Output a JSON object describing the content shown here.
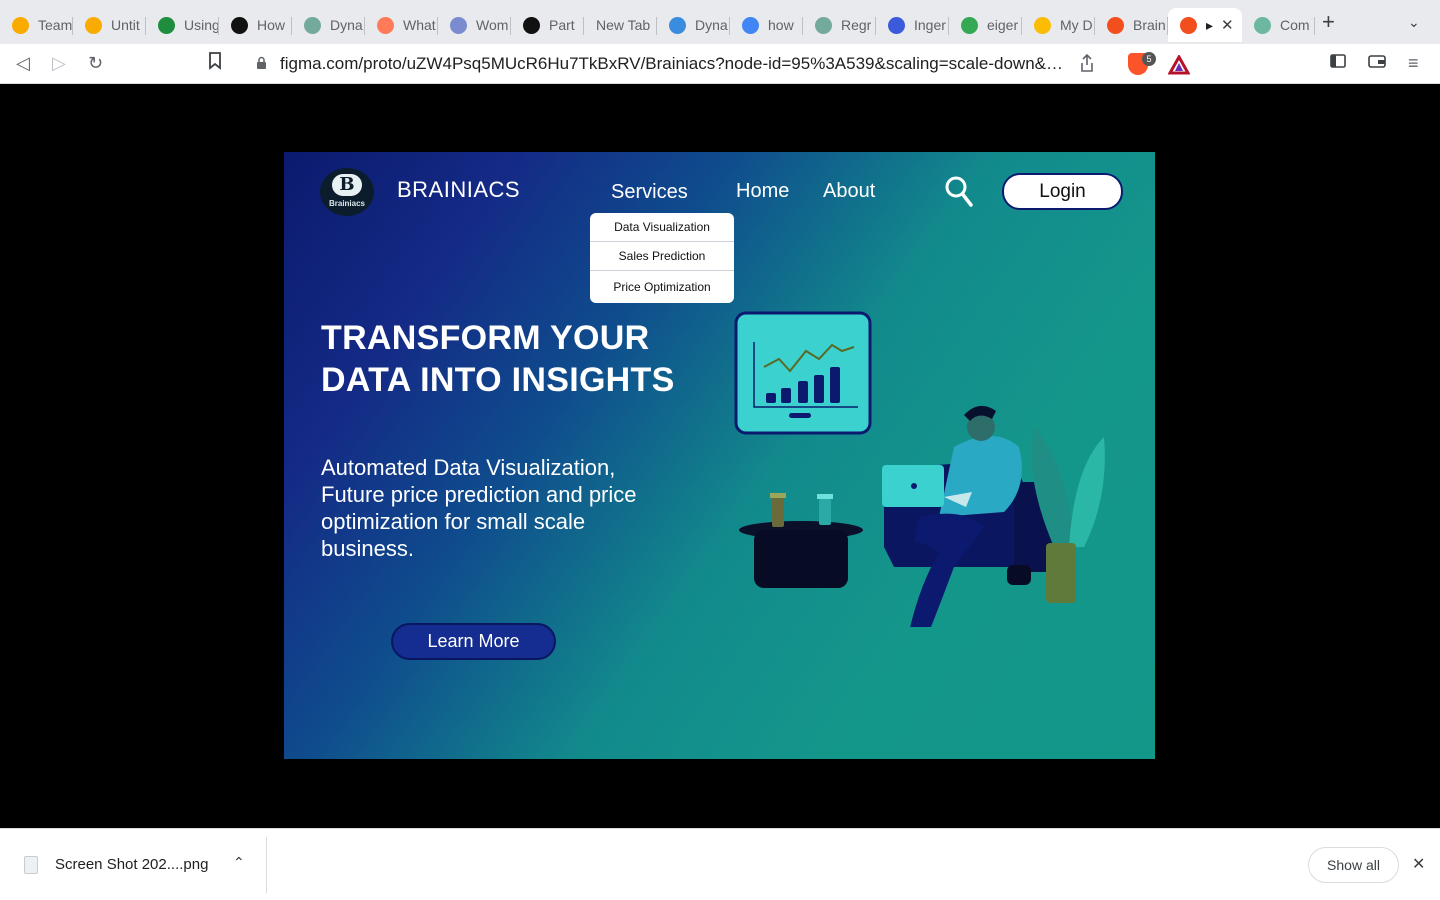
{
  "browser": {
    "tabs": [
      {
        "label": "Team",
        "icon": "colab-icon",
        "color": "#f9ab00"
      },
      {
        "label": "Untit",
        "icon": "colab-icon",
        "color": "#f9ab00"
      },
      {
        "label": "Using",
        "icon": "glasses-icon",
        "color": "#1e8e3e"
      },
      {
        "label": "How",
        "icon": "dark-circle-icon",
        "color": "#111111"
      },
      {
        "label": "Dyna",
        "icon": "openai-icon",
        "color": "#74aa9c"
      },
      {
        "label": "What",
        "icon": "hubspot-icon",
        "color": "#ff7a59"
      },
      {
        "label": "Wom",
        "icon": "alien-icon",
        "color": "#7a8ccf"
      },
      {
        "label": "Part",
        "icon": "podcast-icon",
        "color": "#111111"
      },
      {
        "label": "New Tab",
        "icon": "",
        "color": ""
      },
      {
        "label": "Dyna",
        "icon": "ai-icon",
        "color": "#3a8dde"
      },
      {
        "label": "how",
        "icon": "google-icon",
        "color": "#4285f4"
      },
      {
        "label": "Regr",
        "icon": "openai-icon",
        "color": "#74aa9c"
      },
      {
        "label": "Inger",
        "icon": "blue-shape-icon",
        "color": "#3b5bdb"
      },
      {
        "label": "eiger",
        "icon": "drive-icon",
        "color": "#34a853"
      },
      {
        "label": "My D",
        "icon": "drive-icon",
        "color": "#fbbc04"
      },
      {
        "label": "Brain",
        "icon": "figma-icon",
        "color": "#f24e1e"
      },
      {
        "label": "▸",
        "icon": "figma-icon",
        "color": "#f24e1e",
        "active": true
      },
      {
        "label": "Com",
        "icon": "leaf-icon",
        "color": "#6bb7a0"
      }
    ],
    "url": "figma.com/proto/uZW4Psq5MUcR6Hu7TkBxRV/Brainiacs?node-id=95%3A539&scaling=scale-down&pa...",
    "brave_badge": "5"
  },
  "site": {
    "logo_letter": "B",
    "logo_text": "Brainiacs",
    "brand": "BRAINIACS",
    "nav": {
      "services": "Services",
      "home": "Home",
      "about": "About"
    },
    "login": "Login",
    "dropdown": [
      "Data Visualization",
      "Sales Prediction",
      "Price Optimization"
    ],
    "headline_line1": "TRANSFORM YOUR",
    "headline_line2": "DATA INTO INSIGHTS",
    "subtext": "Automated Data Visualization, Future price prediction and price optimization for small scale business.",
    "cta": "Learn More"
  },
  "downloads": {
    "file_name": "Screen Shot 202....png",
    "show_all": "Show all"
  }
}
